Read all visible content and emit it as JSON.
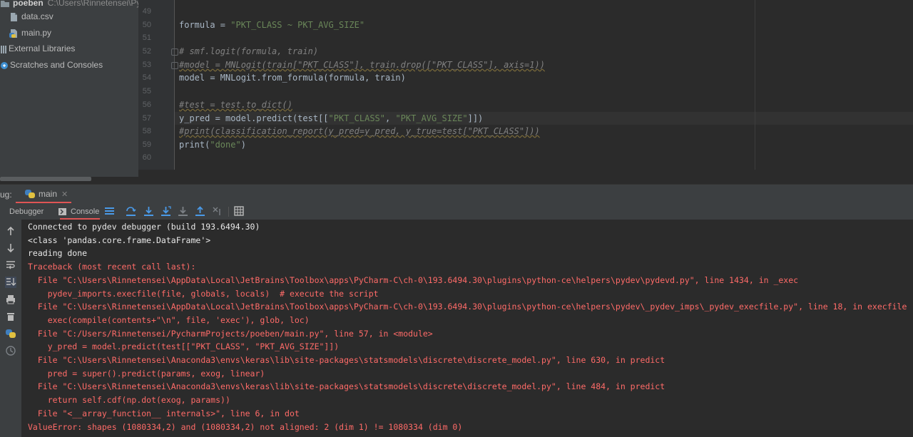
{
  "project": {
    "root_name": "poeben",
    "root_path": "C:\\Users\\Rinnetensei\\PycharmProjects\\poeben",
    "items": [
      {
        "label": "data.csv",
        "icon": "csv-file-icon"
      },
      {
        "label": "main.py",
        "icon": "python-file-icon"
      },
      {
        "label": "External Libraries",
        "icon": "libraries-icon"
      },
      {
        "label": "Scratches and Consoles",
        "icon": "scratches-icon"
      }
    ]
  },
  "editor": {
    "lines": [
      {
        "n": "49",
        "text": ""
      },
      {
        "n": "50",
        "text": "formula = \"PKT_CLASS ~ PKT_AVG_SIZE\""
      },
      {
        "n": "51",
        "text": ""
      },
      {
        "n": "52",
        "text": "# smf.logit(formula, train)"
      },
      {
        "n": "53",
        "text": "#model = MNLogit(train[\"PKT_CLASS\"], train.drop([\"PKT_CLASS\"], axis=1))"
      },
      {
        "n": "54",
        "text": "model = MNLogit.from_formula(formula, train)"
      },
      {
        "n": "55",
        "text": ""
      },
      {
        "n": "56",
        "text": "#test = test.to_dict()"
      },
      {
        "n": "57",
        "text": "y_pred = model.predict(test[[\"PKT_CLASS\", \"PKT_AVG_SIZE\"]])"
      },
      {
        "n": "58",
        "text": "#print(classification_report(y_pred=y_pred, y_true=test[\"PKT_CLASS\"]))"
      },
      {
        "n": "59",
        "text": "print(\"done\")"
      },
      {
        "n": "60",
        "text": ""
      }
    ]
  },
  "debug": {
    "label": "ug:",
    "tab": "main",
    "tabs": [
      "Debugger",
      "Console"
    ]
  },
  "console": {
    "lines": [
      {
        "t": "Connected to pydev debugger (build 193.6494.30)",
        "err": false
      },
      {
        "t": "<class 'pandas.core.frame.DataFrame'>",
        "err": false
      },
      {
        "t": "reading done",
        "err": false
      },
      {
        "t": "Traceback (most recent call last):",
        "err": true
      },
      {
        "t": "  File \"C:\\Users\\Rinnetensei\\AppData\\Local\\JetBrains\\Toolbox\\apps\\PyCharm-C\\ch-0\\193.6494.30\\plugins\\python-ce\\helpers\\pydev\\pydevd.py\", line 1434, in _exec",
        "err": true
      },
      {
        "t": "    pydev_imports.execfile(file, globals, locals)  # execute the script",
        "err": true
      },
      {
        "t": "  File \"C:\\Users\\Rinnetensei\\AppData\\Local\\JetBrains\\Toolbox\\apps\\PyCharm-C\\ch-0\\193.6494.30\\plugins\\python-ce\\helpers\\pydev\\_pydev_imps\\_pydev_execfile.py\", line 18, in execfile",
        "err": true
      },
      {
        "t": "    exec(compile(contents+\"\\n\", file, 'exec'), glob, loc)",
        "err": true
      },
      {
        "t": "  File \"C:/Users/Rinnetensei/PycharmProjects/poeben/main.py\", line 57, in <module>",
        "err": true
      },
      {
        "t": "    y_pred = model.predict(test[[\"PKT_CLASS\", \"PKT_AVG_SIZE\"]])",
        "err": true
      },
      {
        "t": "  File \"C:\\Users\\Rinnetensei\\Anaconda3\\envs\\keras\\lib\\site-packages\\statsmodels\\discrete\\discrete_model.py\", line 630, in predict",
        "err": true
      },
      {
        "t": "    pred = super().predict(params, exog, linear)",
        "err": true
      },
      {
        "t": "  File \"C:\\Users\\Rinnetensei\\Anaconda3\\envs\\keras\\lib\\site-packages\\statsmodels\\discrete\\discrete_model.py\", line 484, in predict",
        "err": true
      },
      {
        "t": "    return self.cdf(np.dot(exog, params))",
        "err": true
      },
      {
        "t": "  File \"<__array_function__ internals>\", line 6, in dot",
        "err": true
      },
      {
        "t": "ValueError: shapes (1080334,2) and (1080334,2) not aligned: 2 (dim 1) != 1080334 (dim 0)",
        "err": true
      }
    ]
  }
}
